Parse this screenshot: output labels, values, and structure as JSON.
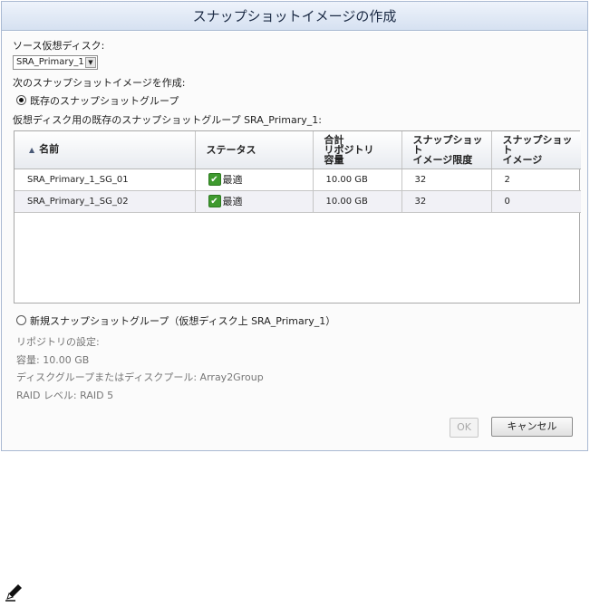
{
  "dialog": {
    "title": "スナップショットイメージの作成",
    "source_label": "ソース仮想ディスク:",
    "source_select_value": "SRA_Primary_1",
    "create_from_label": "次のスナップショットイメージを作成:",
    "option_existing": "既存のスナップショットグループ",
    "existing_groups_label": "仮想ディスク用の既存のスナップショットグループ SRA_Primary_1:",
    "table": {
      "headers": [
        "名前",
        "ステータス",
        "合計\nリポジトリ\n容量",
        "スナップショット\nイメージ限度",
        "スナップショット\nイメージ"
      ],
      "rows": [
        {
          "name": "SRA_Primary_1_SG_01",
          "status": "最適",
          "capacity": "10.00 GB",
          "limit": "32",
          "images": "2"
        },
        {
          "name": "SRA_Primary_1_SG_02",
          "status": "最適",
          "capacity": "10.00 GB",
          "limit": "32",
          "images": "0"
        }
      ]
    },
    "option_new": "新規スナップショットグループ（仮想ディスク上 SRA_Primary_1）",
    "repo_settings_label": "リポジトリの設定:",
    "capacity_line": "容量: 10.00 GB",
    "pool_line": "ディスクグループまたはディスクプール: Array2Group",
    "raid_line": "RAID レベル: RAID 5",
    "ok_label": "OK",
    "cancel_label": "キャンセル"
  },
  "icons": {
    "sort": "sort-ascending-icon",
    "status": "check-icon",
    "note": "pencil-icon"
  },
  "colors": {
    "status_ok": "#3f9a2f",
    "title_bar": "#d6e1f1"
  }
}
